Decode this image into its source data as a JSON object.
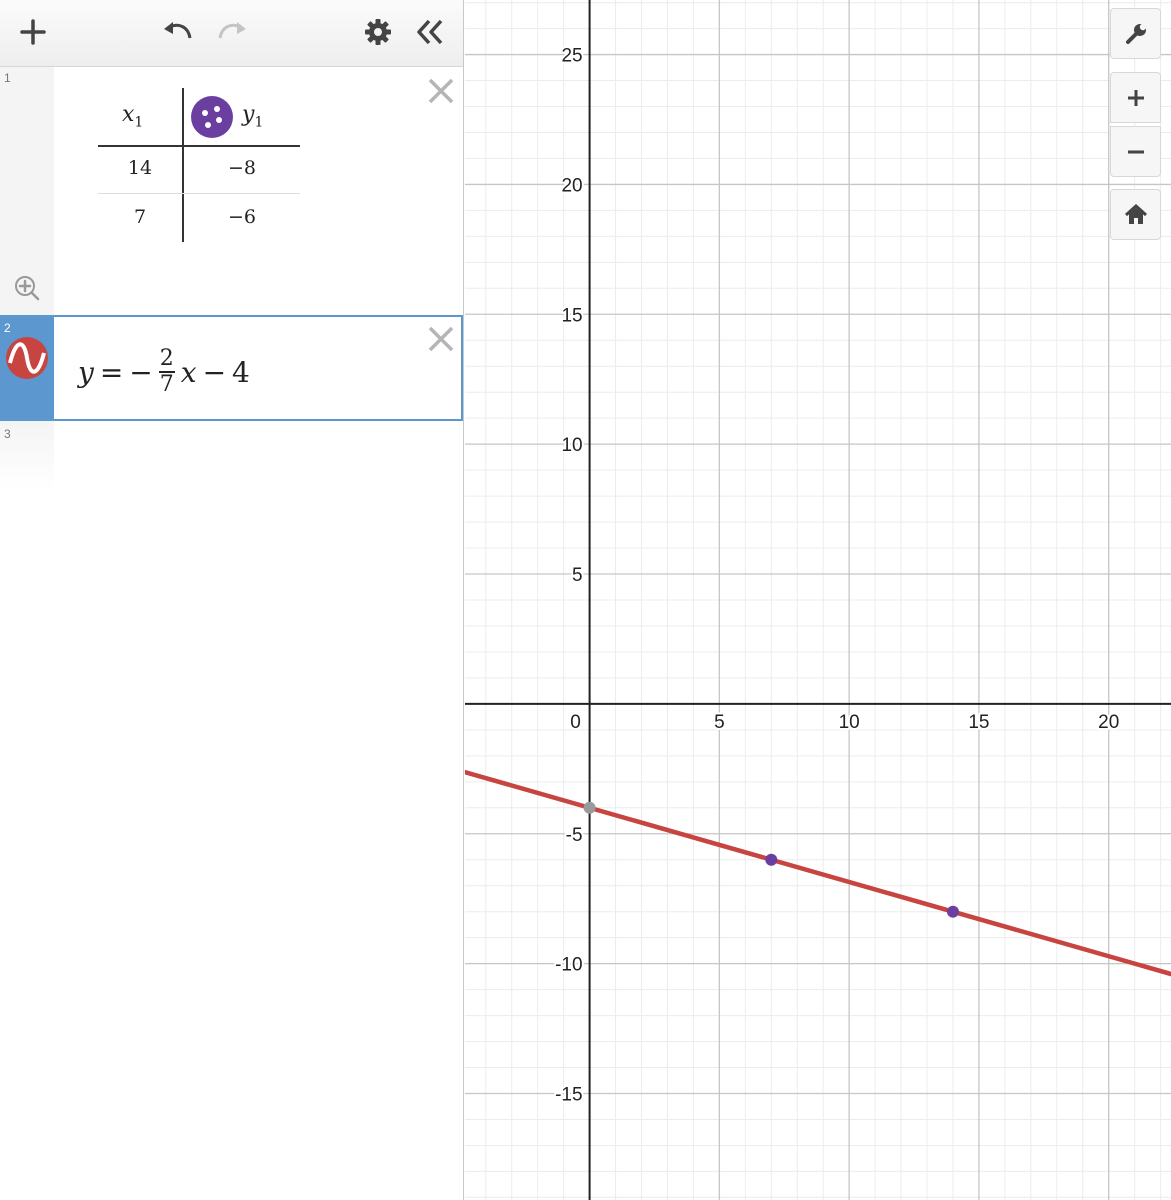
{
  "expressions": [
    {
      "number": "1",
      "type": "table",
      "point_color": "#6b3fa0",
      "columns": [
        "x1",
        "y1"
      ],
      "rows": [
        [
          "14",
          "−8"
        ],
        [
          "7",
          "−6"
        ]
      ]
    },
    {
      "number": "2",
      "type": "expression",
      "color": "#c74440",
      "latex": "y = −(2/7)x − 4",
      "parts": {
        "lhs": "y",
        "eq": "=",
        "minus1": "−",
        "num": "2",
        "den": "7",
        "var": "x",
        "minus2": "−",
        "const": "4"
      }
    },
    {
      "number": "3",
      "type": "empty"
    }
  ],
  "graph": {
    "x_ticks": [
      "0",
      "5",
      "10",
      "15",
      "20"
    ],
    "y_ticks_positive": [
      "25",
      "20",
      "15",
      "10",
      "5"
    ],
    "y_ticks_negative": [
      "-5",
      "-10",
      "-15"
    ]
  },
  "chart_data": {
    "type": "scatter",
    "xlim": [
      -4.8,
      22.4
    ],
    "ylim": [
      -19.1,
      27.1
    ],
    "grid": true,
    "line": {
      "slope": -0.2857142857,
      "intercept": -4,
      "color": "#c74440"
    },
    "points": [
      {
        "x": 14,
        "y": -8
      },
      {
        "x": 7,
        "y": -6
      }
    ],
    "intercept_point": {
      "x": 0,
      "y": -4
    }
  },
  "icons": {
    "toolbar": [
      "plus-icon",
      "undo-icon",
      "redo-icon",
      "gear-icon",
      "collapse-icon"
    ],
    "graph_controls": [
      "wrench-icon",
      "zoom-in-icon",
      "zoom-out-icon",
      "home-icon"
    ]
  }
}
